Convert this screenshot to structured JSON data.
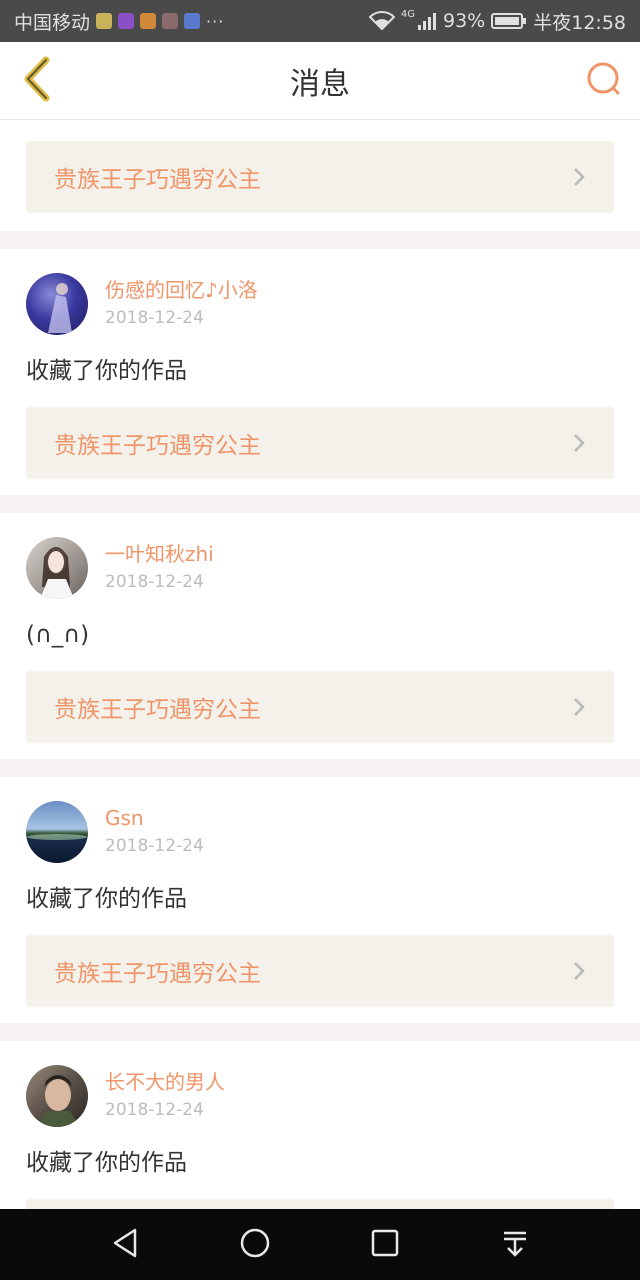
{
  "status_bar": {
    "carrier": "中国移动",
    "dots": "···",
    "network": "4G",
    "battery": "93%",
    "time": "半夜12:58"
  },
  "header": {
    "title": "消息",
    "back_icon": "chevron-left-icon",
    "search_icon": "search-icon"
  },
  "colors": {
    "accent": "#f0956a",
    "back_arrow": "#e0b93a",
    "card_bg": "#f4f1ea",
    "date": "#bdbdbd"
  },
  "first_card": {
    "work_title": "贵族王子巧遇穷公主"
  },
  "messages": [
    {
      "user": "伤感的回忆♪小洛",
      "date": "2018-12-24",
      "text": "收藏了你的作品",
      "work_title": "贵族王子巧遇穷公主"
    },
    {
      "user": "一叶知秋zhi",
      "date": "2018-12-24",
      "text": "(∩_∩)",
      "work_title": "贵族王子巧遇穷公主"
    },
    {
      "user": "Gsn",
      "date": "2018-12-24",
      "text": "收藏了你的作品",
      "work_title": "贵族王子巧遇穷公主"
    },
    {
      "user": "长不大的男人",
      "date": "2018-12-24",
      "text": "收藏了你的作品"
    }
  ],
  "nav_bar": {
    "buttons": [
      "back-triangle-icon",
      "home-circle-icon",
      "recents-square-icon",
      "notification-pull-icon"
    ]
  }
}
